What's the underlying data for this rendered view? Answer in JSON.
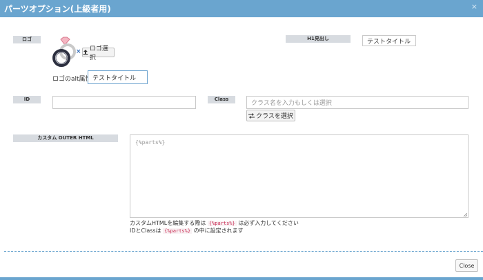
{
  "window": {
    "title": "パーツオプション(上級者用)",
    "close_icon": "×"
  },
  "logo": {
    "label": "ロゴ",
    "remove_icon": "×",
    "select_button": "ロゴ選択",
    "alt_label": "ロゴのalt属性:",
    "alt_value": "テストタイトル"
  },
  "h1": {
    "label": "H1見出し",
    "value": "テストタイトル"
  },
  "id_field": {
    "label": "ID",
    "value": ""
  },
  "class_field": {
    "label": "Class",
    "placeholder": "クラス名を入力もしくは選択",
    "select_button": "クラスを選択"
  },
  "outer_html": {
    "label": "カスタム OUTER HTML",
    "placeholder": "{%parts%}",
    "help1_pre": "カスタムHTMLを編集する際は",
    "help1_code": "{%parts%}",
    "help1_post": "は必ず入力してください",
    "help2_pre": "IDとClassは",
    "help2_code": "{%parts%}",
    "help2_post": "の中に設定されます"
  },
  "footer": {
    "close_button": "Close"
  },
  "colors": {
    "accent": "#6aa5cf",
    "label_chip": "#d7dbe0",
    "code": "#c7254e"
  }
}
